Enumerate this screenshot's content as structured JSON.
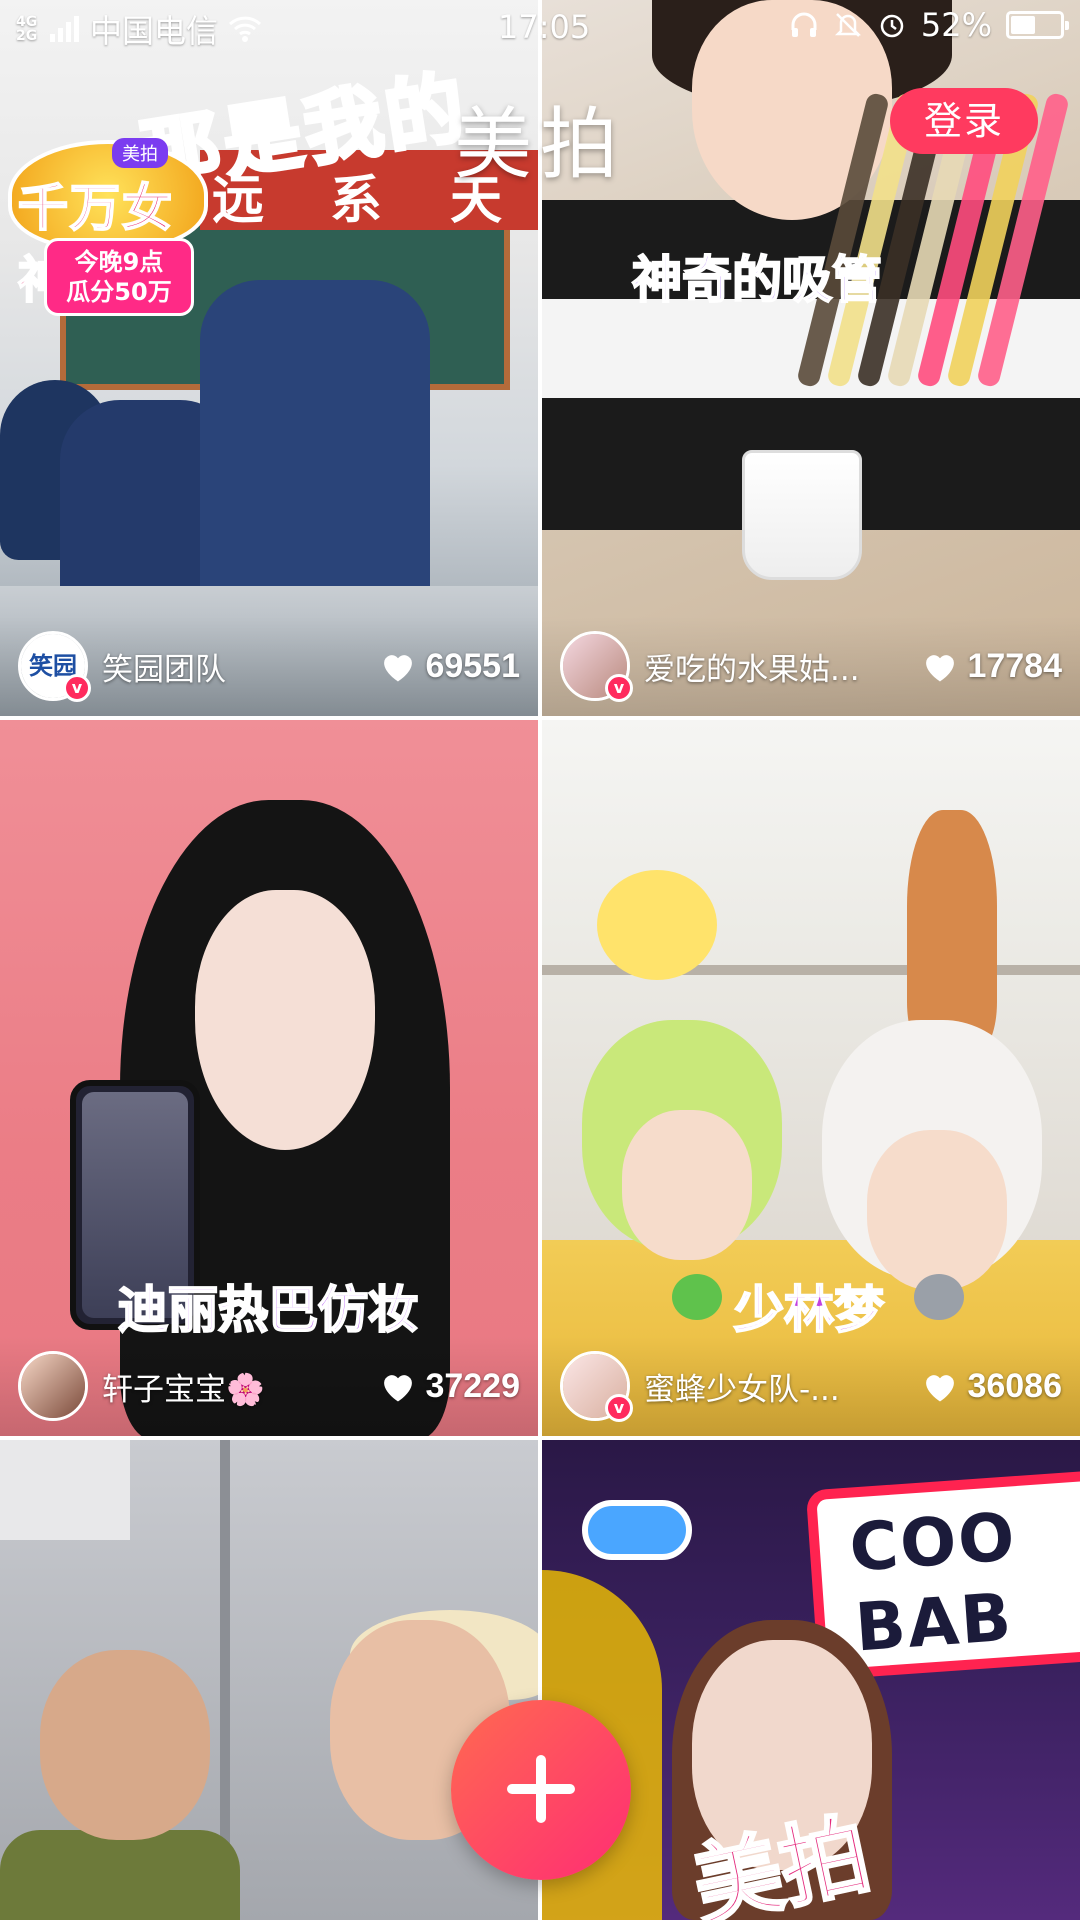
{
  "status_bar": {
    "network": "4G\n2G",
    "carrier": "中国电信",
    "time": "17:05",
    "battery_percent_text": "52%",
    "battery_level": 0.52,
    "icons": [
      "signal-icon",
      "wifi-icon",
      "headphones-icon",
      "bell-muted-icon",
      "alarm-icon",
      "battery-icon"
    ]
  },
  "header": {
    "app_title": "美拍",
    "login_label": "登录",
    "login_color": "#ff3a5f"
  },
  "feed": [
    {
      "overlay_text": "那是我的",
      "banner_chars": [
        "远",
        "系",
        "天"
      ],
      "promo": {
        "app": "美拍",
        "main": "千万女神",
        "sub": "今晚9点\n瓜分50万"
      },
      "author": "笑园团队",
      "avatar_text": "笑园",
      "verified": true,
      "likes": "69551"
    },
    {
      "overlay_text": "神奇的吸管",
      "author": "爱吃的水果姑...",
      "verified": true,
      "likes": "17784"
    },
    {
      "overlay_text": "迪丽热巴仿妆",
      "author": "轩子宝宝🌸",
      "verified": false,
      "likes": "37229"
    },
    {
      "overlay_text": "少林梦",
      "author": "蜜蜂少女队-...",
      "verified": true,
      "likes": "36086"
    },
    {
      "overlay_text": "",
      "author": "",
      "likes": ""
    },
    {
      "overlay_text": "美拍",
      "sign_text": [
        "COO",
        "BAB"
      ],
      "author": "",
      "likes": ""
    }
  ],
  "fab": {
    "icon": "plus-icon",
    "colors": [
      "#ff6a50",
      "#ff2d74"
    ]
  }
}
